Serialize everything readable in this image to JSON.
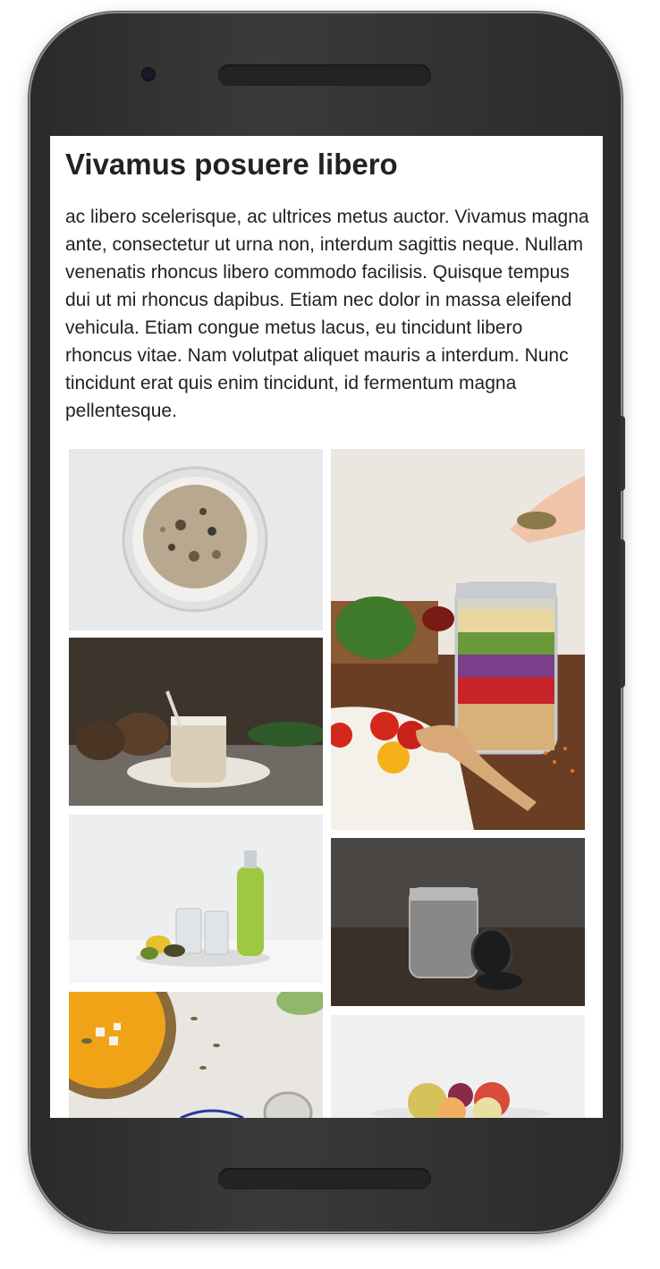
{
  "article": {
    "title": "Vivamus posuere libero",
    "body": "ac libero scelerisque, ac ultrices metus auctor. Vivamus magna ante, consectetur ut urna non, interdum sagittis neque. Nullam venenatis rhoncus libero commodo facilisis. Quisque tempus dui ut mi rhoncus dapibus. Etiam nec dolor in massa eleifend vehicula. Etiam congue metus lacus, eu tincidunt libero rhoncus vitae. Nam volutpat aliquet mauris a interdum. Nunc tincidunt erat quis enim tincidunt, id fermentum magna pellentesque."
  },
  "gallery": {
    "left_column": [
      "granola-bowl",
      "coconut-smoothie",
      "kiwi-drink",
      "orange-soup"
    ],
    "right_column": [
      "salad-jar",
      "cookie-milk-jar",
      "fruit-bowl"
    ]
  }
}
